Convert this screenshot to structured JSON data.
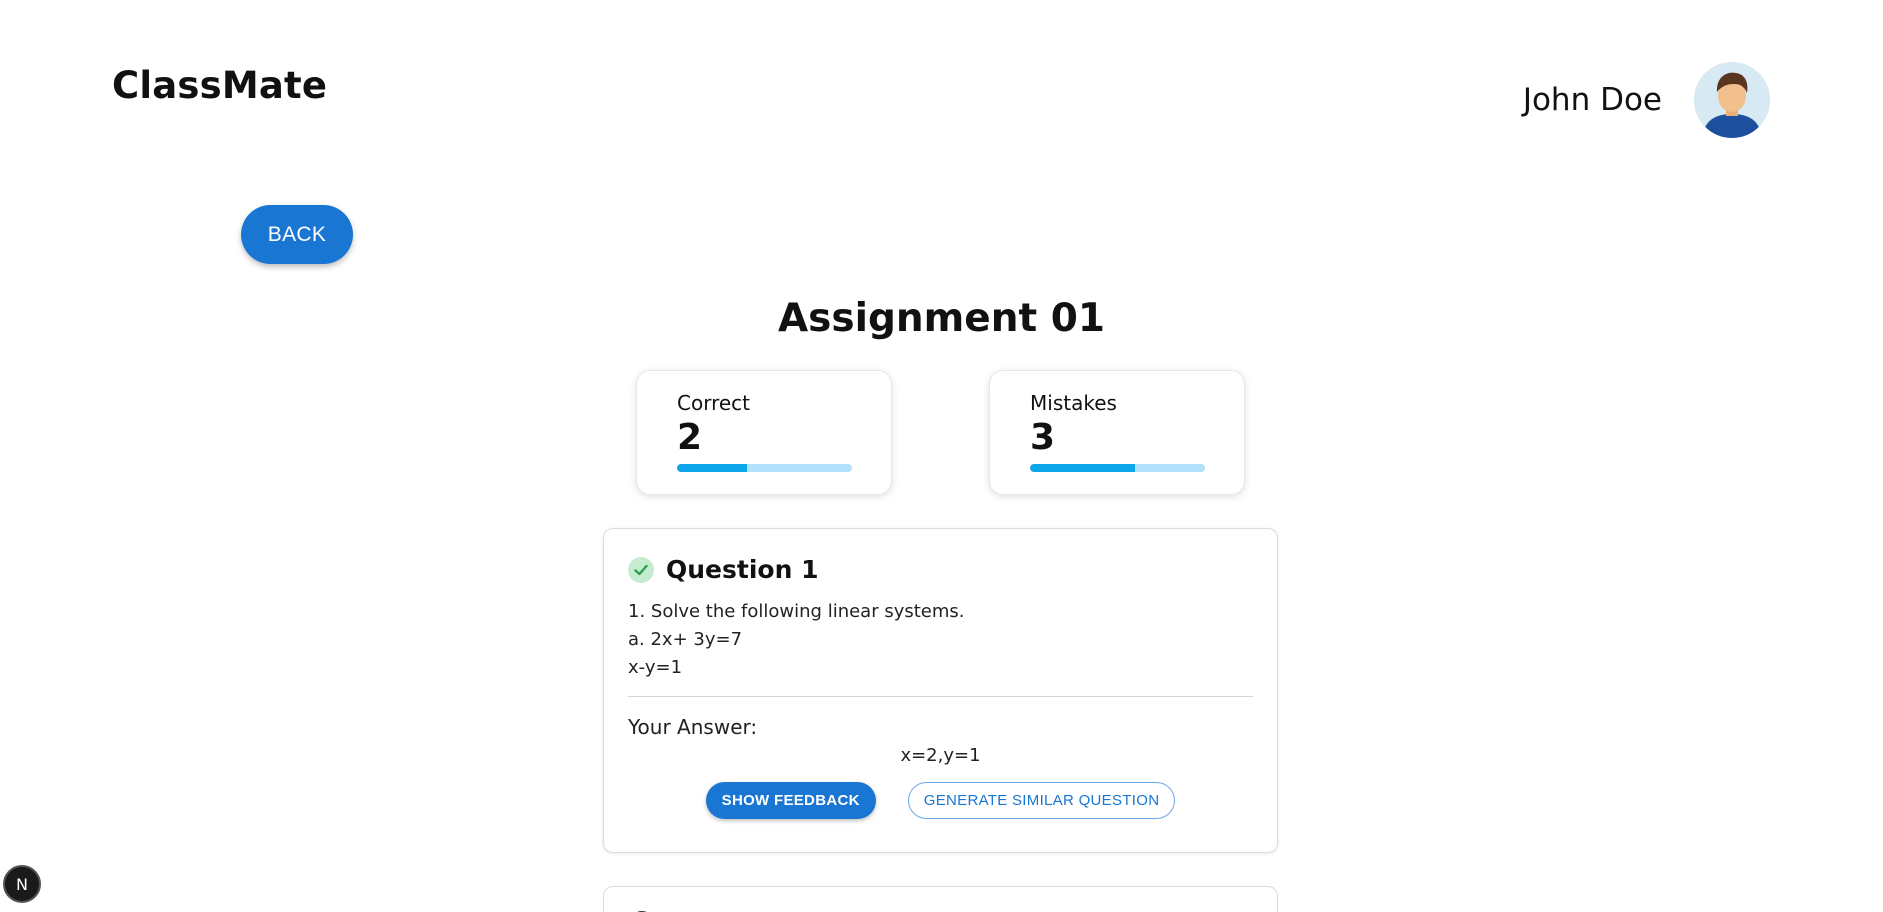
{
  "header": {
    "brand": "ClassMate",
    "user_name": "John Doe"
  },
  "nav": {
    "back_label": "BACK"
  },
  "assignment": {
    "title": "Assignment 01"
  },
  "stats": {
    "correct": {
      "label": "Correct",
      "value": "2",
      "progress": 0.4
    },
    "mistakes": {
      "label": "Mistakes",
      "value": "3",
      "progress": 0.6
    }
  },
  "questions": [
    {
      "title": "Question 1",
      "status": "correct",
      "lines": [
        "1. Solve the following linear systems.",
        "a. 2x+ 3y=7",
        "x-y=1"
      ],
      "answer_label": "Your Answer:",
      "answer": "x=2,y=1",
      "feedback_label": "SHOW FEEDBACK",
      "similar_label": "GENERATE SIMILAR QUESTION"
    }
  ],
  "dev_badge": {
    "letter": "N"
  },
  "colors": {
    "primary": "#1976d2",
    "progress_fill": "#0ea5e9",
    "progress_track": "#b3e0fa",
    "check_bg": "#c6ecd0",
    "check_mark": "#2e9e4f"
  }
}
